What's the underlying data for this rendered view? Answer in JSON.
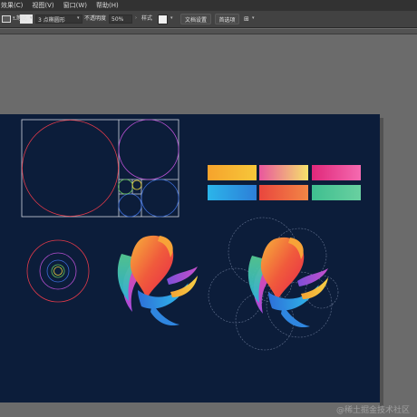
{
  "menu": {
    "items": [
      "效果(C)",
      "视图(V)",
      "窗口(W)",
      "帮助(H)"
    ]
  },
  "control_bar": {
    "stroke_weight_label": "等比",
    "brush_value": "3 点椭圆形",
    "opacity_label": "不透明度",
    "opacity_value": "50%",
    "style_label": "样式",
    "doc_setup_button": "文档设置",
    "preferences_button": "首选项"
  },
  "swatches": [
    {
      "name": "orange-yellow",
      "from": "#f6a32c",
      "to": "#f6c73a"
    },
    {
      "name": "pink-yellow",
      "from": "#e9579d",
      "to": "#f5e26b"
    },
    {
      "name": "magenta-pink",
      "from": "#e0287a",
      "to": "#f56ab0"
    },
    {
      "name": "cyan-blue",
      "from": "#2bb5ea",
      "to": "#2d7ed8"
    },
    {
      "name": "red-orange",
      "from": "#e9463e",
      "to": "#f28645"
    },
    {
      "name": "green-teal",
      "from": "#3fbf90",
      "to": "#69d0a0"
    }
  ],
  "colors": {
    "artboard": "#0c1d3a",
    "guide_red": "#e23a4a",
    "guide_violet": "#b54fd0",
    "guide_blue": "#3b6bd6",
    "guide_green": "#63c25a",
    "guide_yellow": "#e9d23c"
  },
  "watermark": "@稀土掘金技术社区"
}
